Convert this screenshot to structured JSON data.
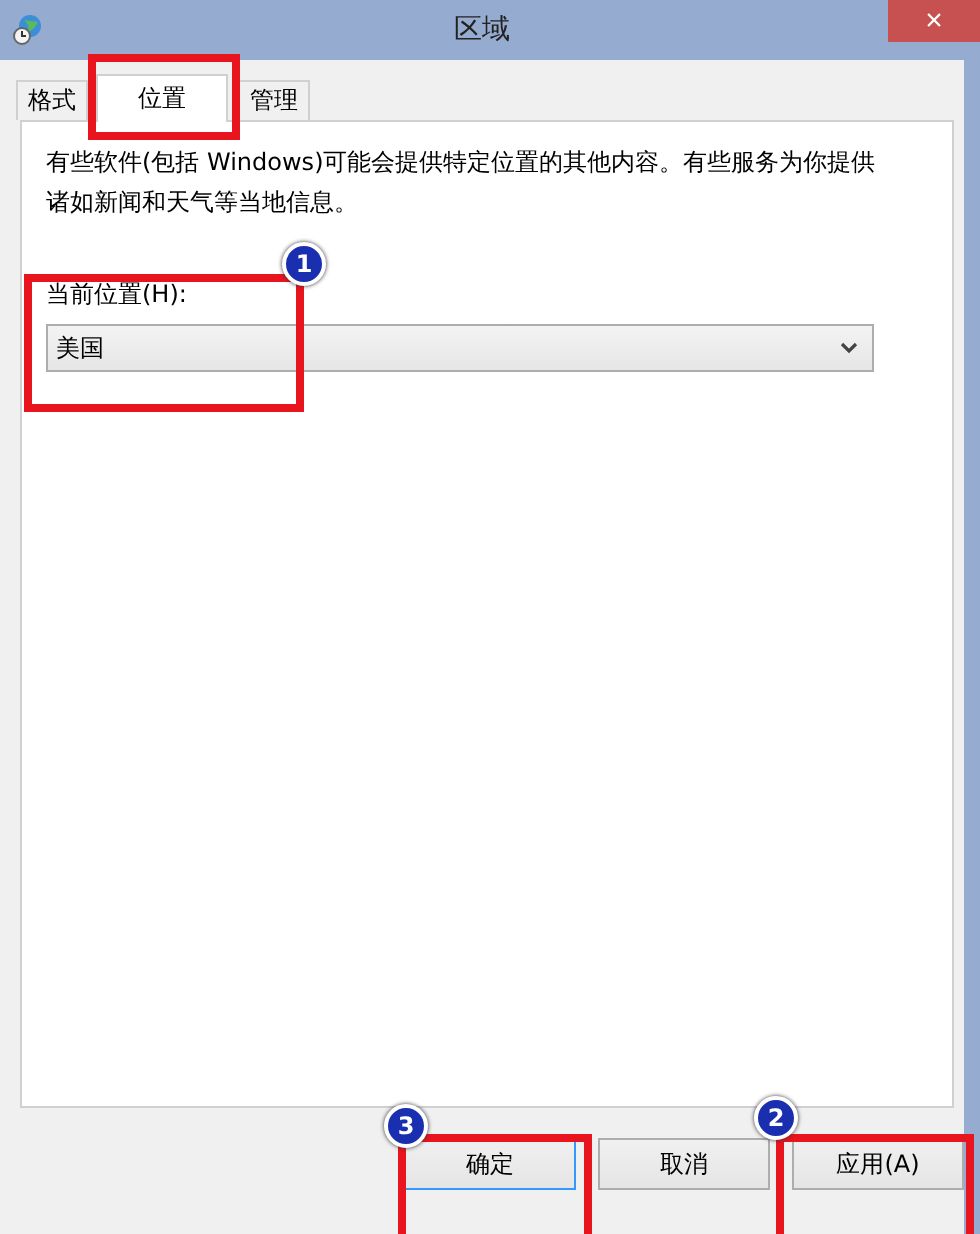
{
  "window": {
    "title": "区域",
    "close": "×"
  },
  "tabs": [
    {
      "label": "格式",
      "selected": false
    },
    {
      "label": "位置",
      "selected": true
    },
    {
      "label": "管理",
      "selected": false
    }
  ],
  "description": "有些软件(包括 Windows)可能会提供特定位置的其他内容。有些服务为你提供诸如新闻和天气等当地信息。",
  "location": {
    "label": "当前位置(H):",
    "value": "美国"
  },
  "buttons": [
    {
      "label": "确定",
      "selected": true
    },
    {
      "label": "取消",
      "selected": false
    },
    {
      "label": "应用(A)",
      "selected": false
    }
  ],
  "annotations": [
    {
      "number": "1"
    },
    {
      "number": "2"
    },
    {
      "number": "3"
    }
  ]
}
